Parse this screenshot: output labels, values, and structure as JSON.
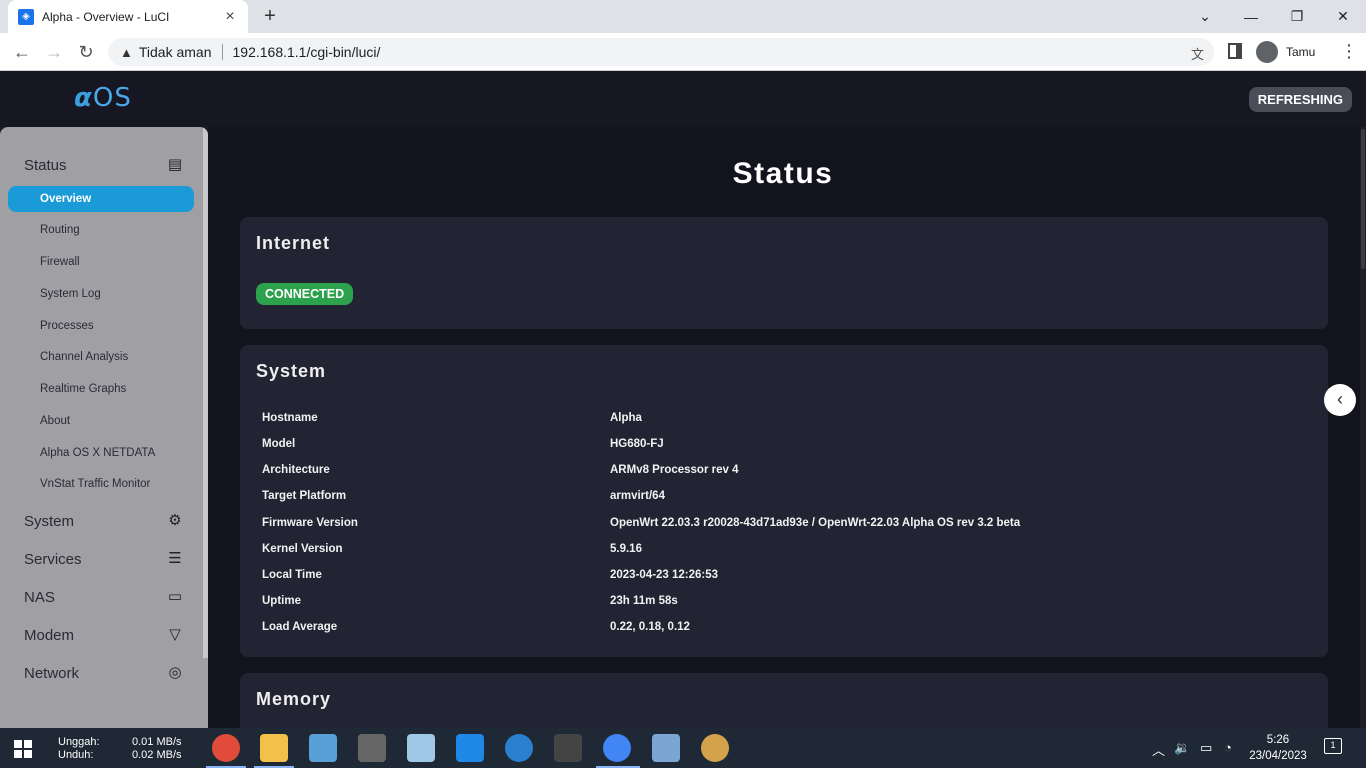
{
  "browser": {
    "tab_title": "Alpha - Overview - LuCI",
    "new_tab": "+",
    "security_text": "Tidak aman",
    "url": "192.168.1.1/cgi-bin/luci/",
    "profile_name": "Tamu"
  },
  "header": {
    "logo_alpha": "α",
    "logo_os": "OS",
    "refresh_label": "REFRESHING"
  },
  "sidebar": {
    "sections": [
      {
        "label": "Status",
        "icon": "status-icon"
      },
      {
        "label": "System",
        "icon": "gear-icon"
      },
      {
        "label": "Services",
        "icon": "sliders-icon"
      },
      {
        "label": "NAS",
        "icon": "folder-icon"
      },
      {
        "label": "Modem",
        "icon": "filter-icon"
      },
      {
        "label": "Network",
        "icon": "globe-icon"
      }
    ],
    "status_items": [
      "Overview",
      "Routing",
      "Firewall",
      "System Log",
      "Processes",
      "Channel Analysis",
      "Realtime Graphs",
      "About",
      "Alpha OS X NETDATA",
      "VnStat Traffic Monitor"
    ]
  },
  "main": {
    "title": "Status",
    "internet": {
      "heading": "Internet",
      "status": "CONNECTED",
      "status_color": "#2ca24c"
    },
    "system": {
      "heading": "System",
      "rows": [
        {
          "key": "Hostname",
          "value": "Alpha"
        },
        {
          "key": "Model",
          "value": "HG680-FJ"
        },
        {
          "key": "Architecture",
          "value": "ARMv8 Processor rev 4"
        },
        {
          "key": "Target Platform",
          "value": "armvirt/64"
        },
        {
          "key": "Firmware Version",
          "value": "OpenWrt 22.03.3 r20028-43d71ad93e / OpenWrt-22.03 Alpha OS rev 3.2 beta"
        },
        {
          "key": "Kernel Version",
          "value": "5.9.16"
        },
        {
          "key": "Local Time",
          "value": "2023-04-23 12:26:53"
        },
        {
          "key": "Uptime",
          "value": "23h 11m 58s"
        },
        {
          "key": "Load Average",
          "value": "0.22, 0.18, 0.12"
        }
      ]
    },
    "memory": {
      "heading": "Memory"
    }
  },
  "taskbar": {
    "upload_label": "Unggah:",
    "download_label": "Unduh:",
    "upload_value": "0.01 MB/s",
    "download_value": "0.02 MB/s",
    "time": "5:26",
    "date": "23/04/2023",
    "notifications": "1"
  }
}
